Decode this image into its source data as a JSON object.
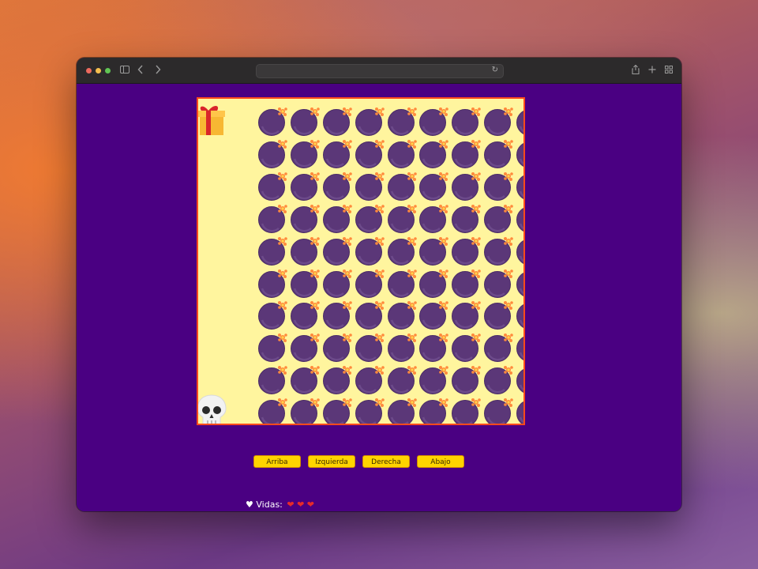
{
  "browser": {
    "url": "",
    "icons": [
      "sidebar-icon",
      "back-icon",
      "forward-icon",
      "reload-icon",
      "share-icon",
      "new-tab-icon",
      "tab-overview-icon"
    ]
  },
  "game": {
    "grid": {
      "rows": 10,
      "cols": 10
    },
    "start_cell": {
      "row": 0,
      "col": 0,
      "icon": "gift-icon"
    },
    "player_cell": {
      "row": 9,
      "col": 0,
      "icon": "skull-icon"
    },
    "cell_icon": "bomb-icon",
    "colors": {
      "background": "#4a0082",
      "board": "#fff59e",
      "board_border": "#ff4a1c",
      "button": "#ffd400"
    }
  },
  "controls": {
    "up_label": "Arriba",
    "left_label": "Izquierda",
    "right_label": "Derecha",
    "down_label": "Abajo"
  },
  "status": {
    "lives_icon": "♥",
    "lives_label": "Vidas:",
    "lives_count": 3,
    "lives_hearts": "❤ ❤ ❤"
  }
}
